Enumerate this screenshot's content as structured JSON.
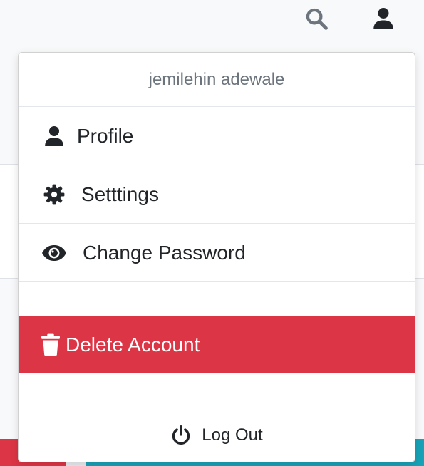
{
  "navbar": {
    "search_icon": "search-icon",
    "user_icon": "user-icon"
  },
  "user_menu": {
    "username": "jemilehin adewale",
    "items": [
      {
        "label": "Profile",
        "icon": "user-icon"
      },
      {
        "label": "Setttings",
        "icon": "gear-icon"
      },
      {
        "label": "Change Password",
        "icon": "eye-icon"
      }
    ],
    "delete_label": "Delete Account",
    "delete_icon": "trash-icon",
    "logout_label": "Log Out",
    "logout_icon": "power-icon"
  },
  "colors": {
    "danger": "#dc3545",
    "teal": "#17a2b8",
    "muted_text": "#6c757d",
    "icon_dark": "#212529",
    "icon_grey": "#6c757d"
  }
}
